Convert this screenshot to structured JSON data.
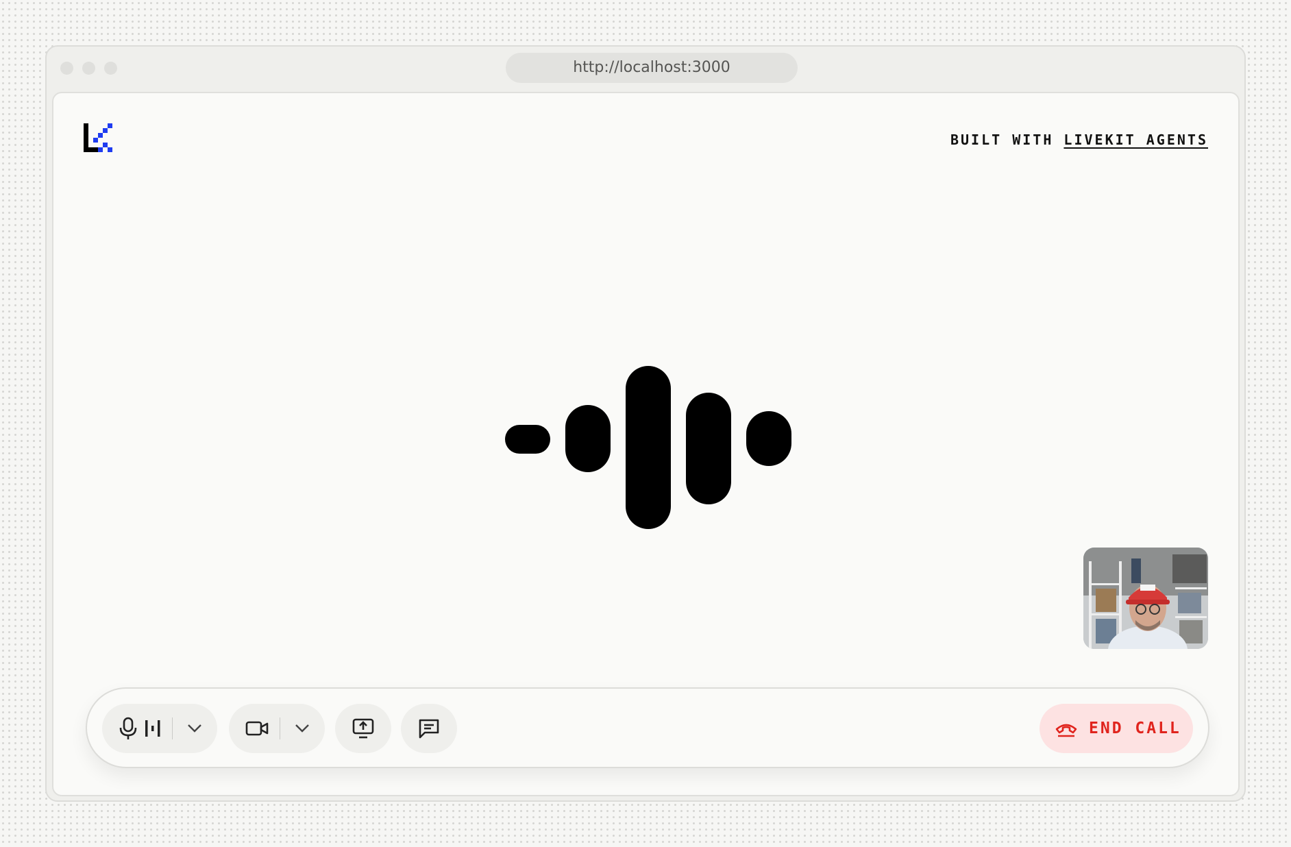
{
  "browser": {
    "url": "http://localhost:3000"
  },
  "header": {
    "logo_icon": "livekit-logo",
    "built_prefix": "BUILT WITH",
    "built_link": "LIVEKIT AGENTS"
  },
  "agent_visualizer": {
    "bar_count": 5
  },
  "self_view": {
    "icon": "camera-preview"
  },
  "controls": {
    "microphone_icon": "microphone-icon",
    "audio_level_icon": "audio-level-icon",
    "camera_icon": "camera-icon",
    "screen_share_icon": "screen-share-icon",
    "chat_icon": "chat-icon",
    "end_call_label": "END CALL",
    "end_call_color": "#e0241d"
  }
}
